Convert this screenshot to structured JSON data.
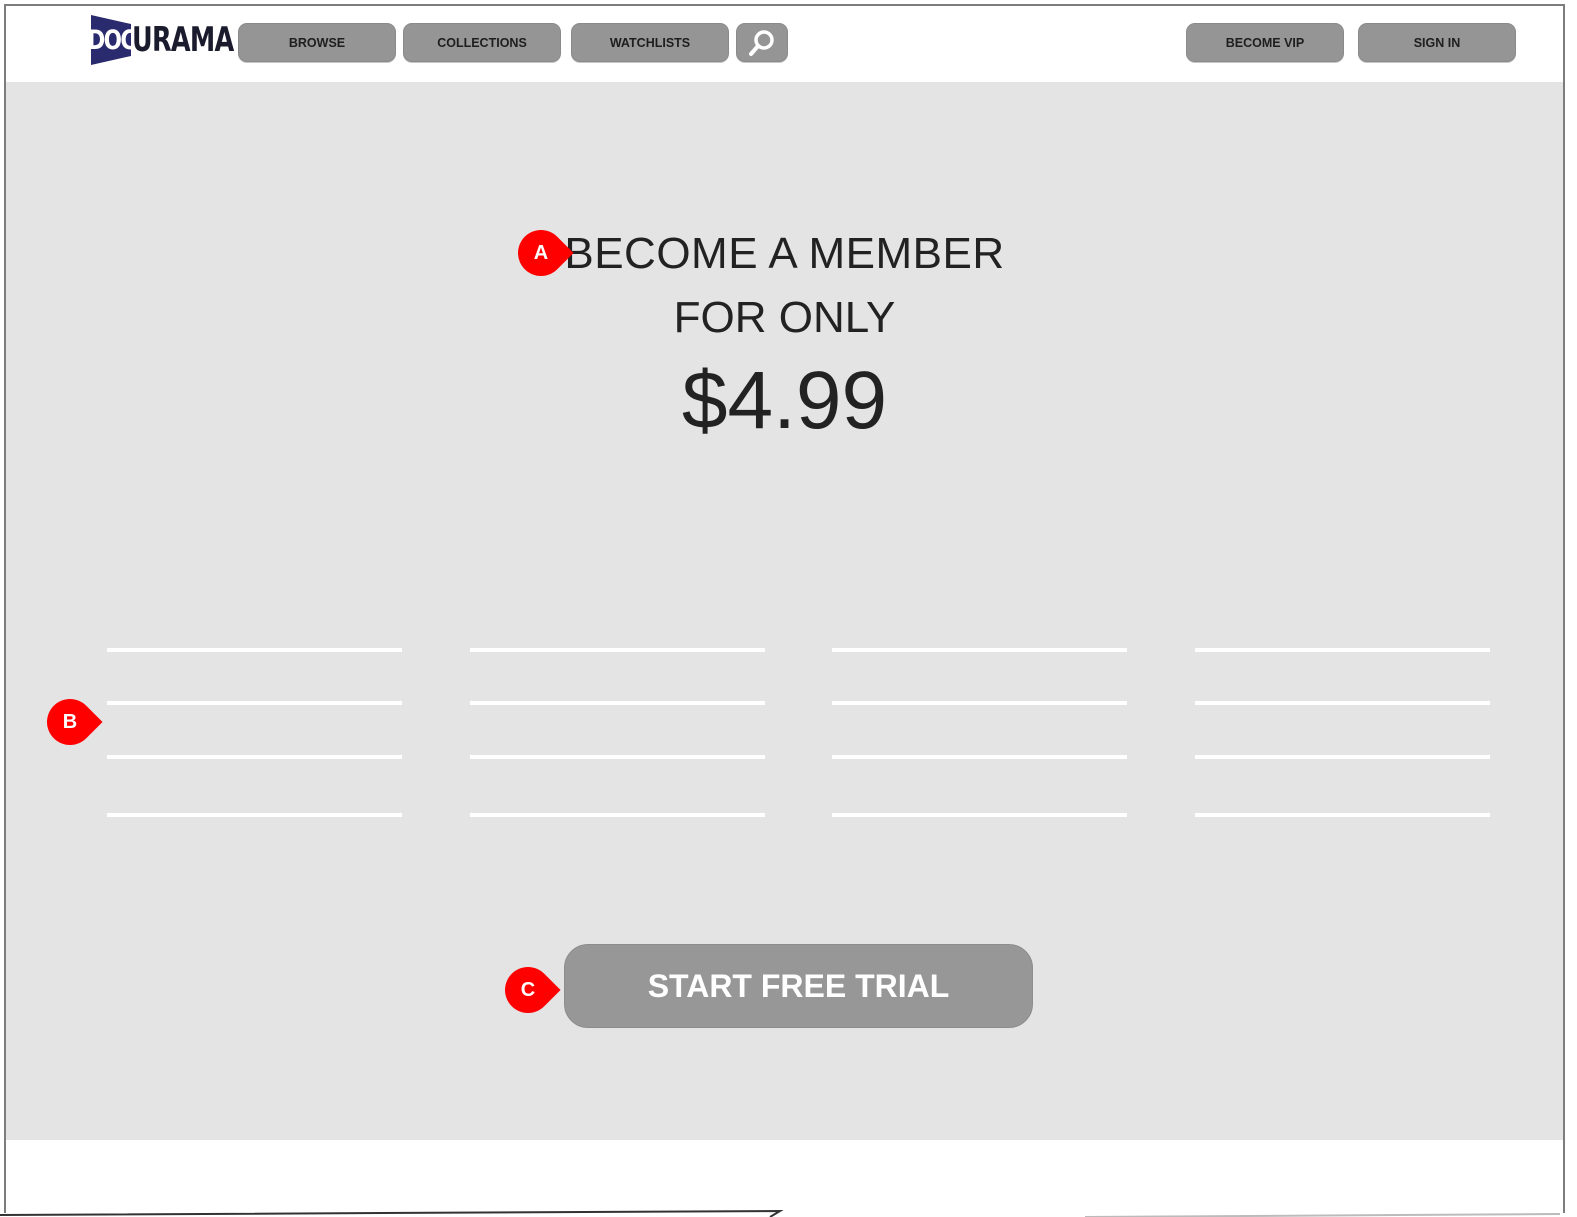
{
  "header": {
    "logo": {
      "text_a": "DOC",
      "text_b": "URAMA"
    },
    "nav": [
      {
        "label": "BROWSE"
      },
      {
        "label": "COLLECTIONS"
      },
      {
        "label": "WATCHLISTS"
      }
    ],
    "search_icon": "search-icon",
    "right": [
      {
        "label": "BECOME VIP"
      },
      {
        "label": "SIGN IN"
      }
    ]
  },
  "hero": {
    "headline_line1": "BECOME A MEMBER",
    "headline_line2": "FOR ONLY",
    "price": "$4.99",
    "cta_label": "START FREE TRIAL"
  },
  "annotations": {
    "a": "A",
    "b": "B",
    "c": "C"
  },
  "colors": {
    "hero_bg": "#e4e4e4",
    "button_bg": "#959595",
    "marker": "#ff0000",
    "logo_flag": "#2a2a6e"
  }
}
